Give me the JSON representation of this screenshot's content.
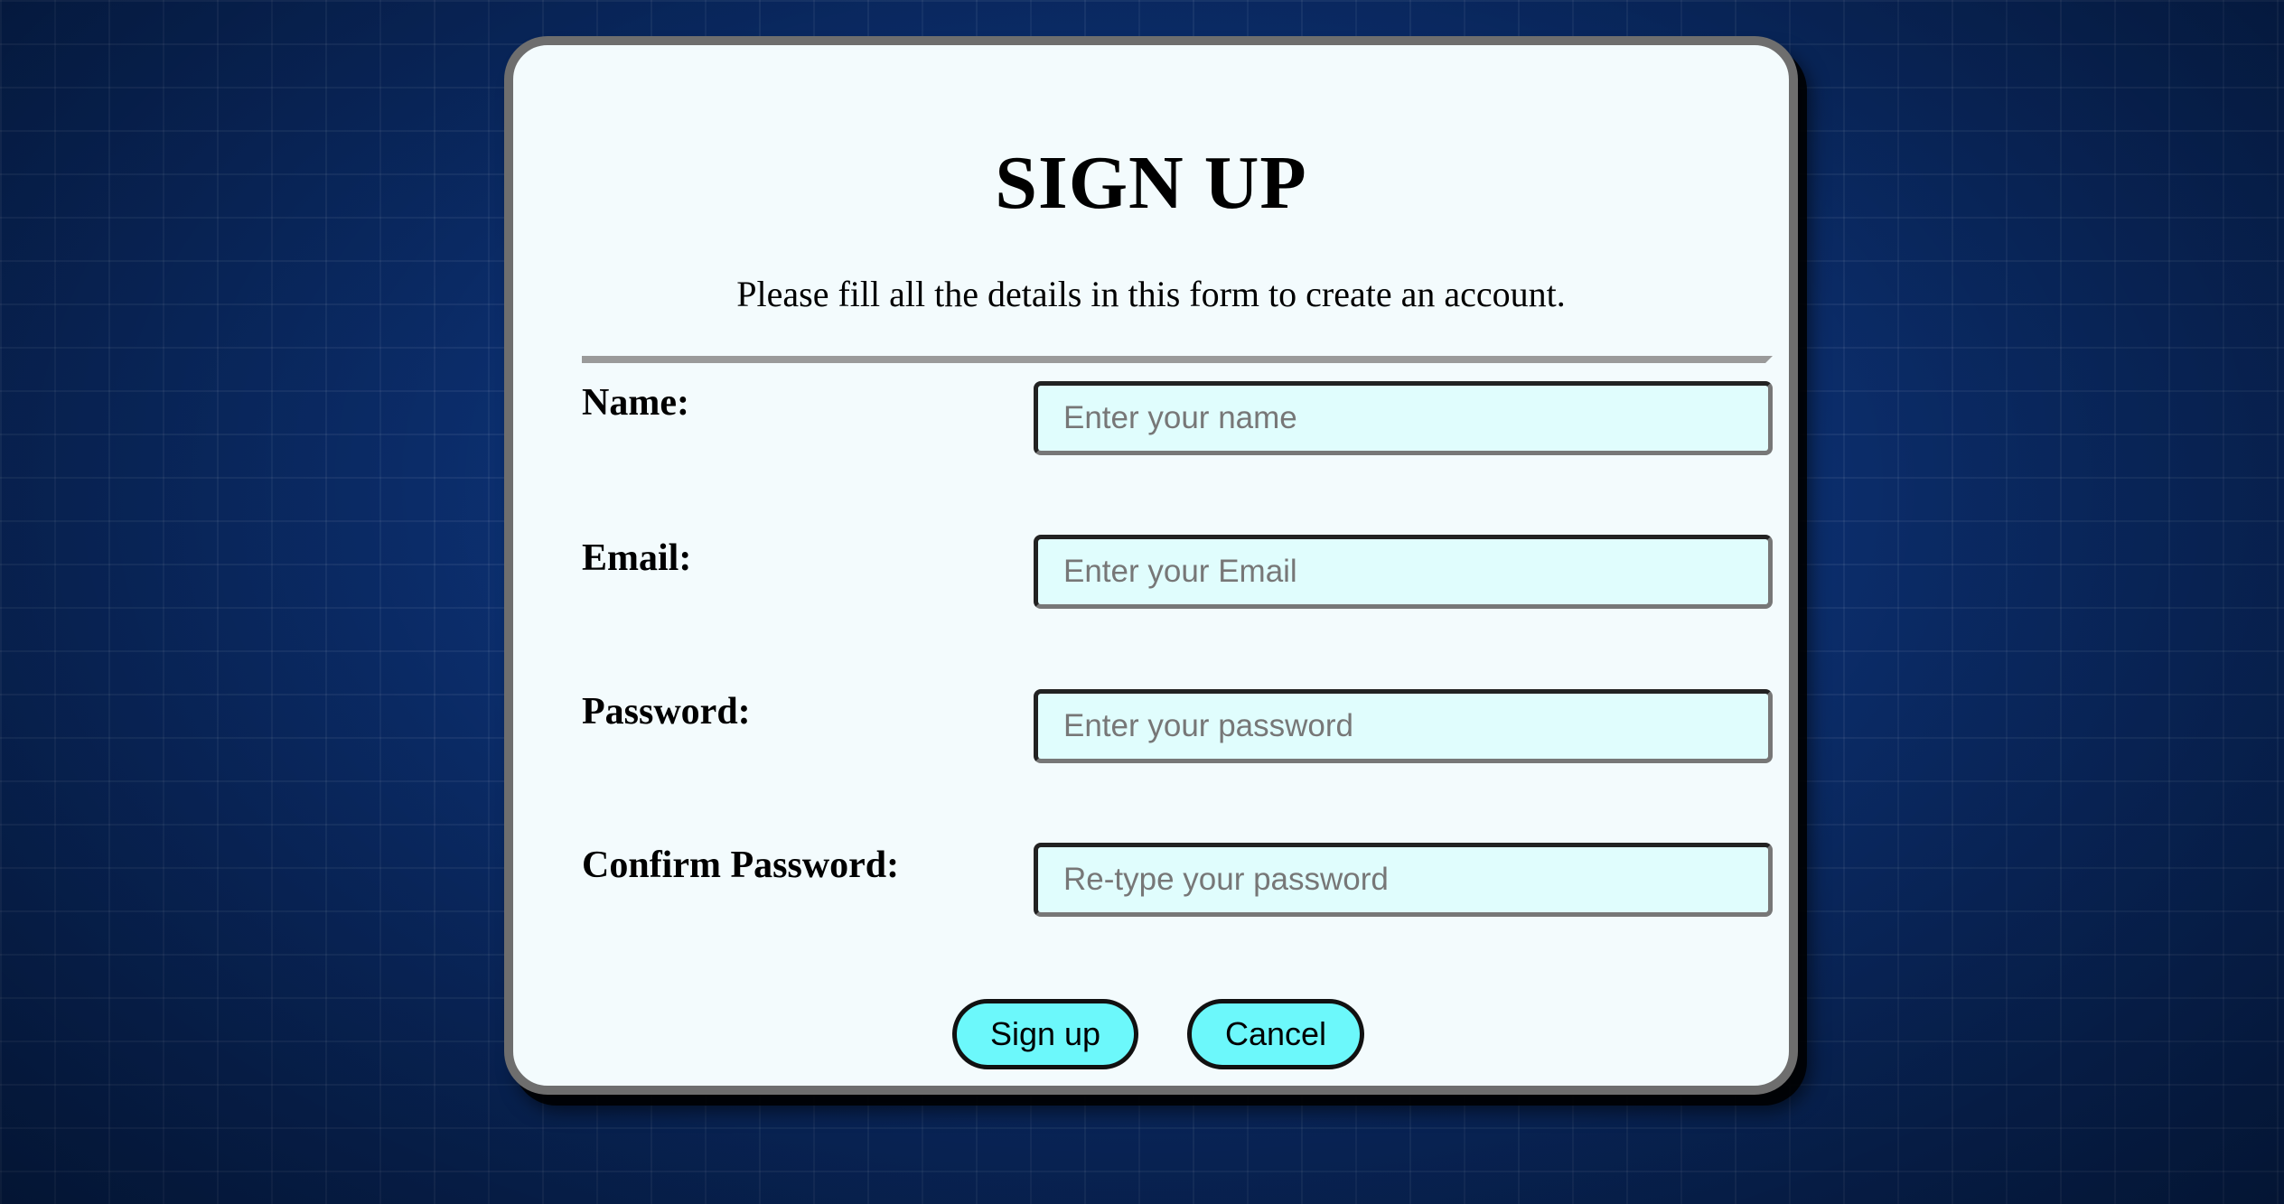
{
  "page": {
    "background_color": "#0a2a66",
    "card_color": "#f3fbfd",
    "accent_color": "#6cf8fb"
  },
  "form": {
    "title": "SIGN UP",
    "subtitle": "Please fill all the details in this form to create an account.",
    "fields": [
      {
        "label": "Name:",
        "placeholder": "Enter your name",
        "value": ""
      },
      {
        "label": "Email:",
        "placeholder": "Enter your Email",
        "value": ""
      },
      {
        "label": "Password:",
        "placeholder": "Enter your password",
        "value": ""
      },
      {
        "label": "Confirm Password:",
        "placeholder": "Re-type your password",
        "value": ""
      }
    ],
    "buttons": {
      "signup_label": "Sign up",
      "cancel_label": "Cancel"
    }
  }
}
